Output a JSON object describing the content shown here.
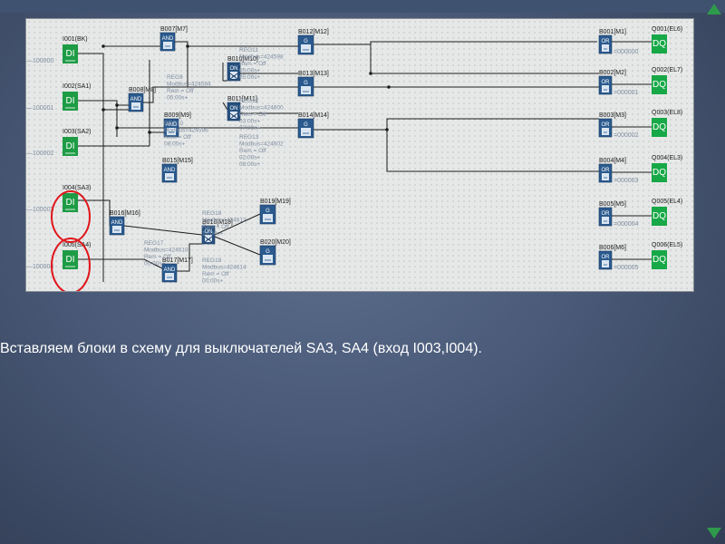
{
  "caption": "Вставляем блоки в схему для выключателей SA3, SA4 (вход I003,I004).",
  "colors": {
    "di_block": "#1e9c45",
    "q_block": "#17a847",
    "func_block": "#2a5a8e",
    "wire": "#1c1c1c",
    "note_text": "#7f8ea0",
    "highlight": "#e0161b",
    "slide_accent": "#2f9a4c"
  },
  "inputs": [
    {
      "label": "I001(BK)",
      "block": "DI",
      "ref": "100000"
    },
    {
      "label": "I002(SA1)",
      "block": "DI",
      "ref": "100001"
    },
    {
      "label": "I003(SA2)",
      "block": "DI",
      "ref": "100002"
    },
    {
      "label": "I004(SA3)",
      "block": "DI",
      "ref": "100003"
    },
    {
      "label": "I005(SA4)",
      "block": "DI",
      "ref": "100004"
    }
  ],
  "outputs": [
    {
      "label": "Q001(EL6)",
      "block": "DQ"
    },
    {
      "label": "Q002(EL7)",
      "block": "DQ"
    },
    {
      "label": "Q003(EL8)",
      "block": "DQ"
    },
    {
      "label": "Q004(EL3)",
      "block": "DQ"
    },
    {
      "label": "Q005(EL4)",
      "block": "DQ"
    },
    {
      "label": "Q006(EL5)",
      "block": "DQ"
    }
  ],
  "or_blocks": [
    {
      "label": "B001[M1]",
      "block": "OR",
      "ref": "=000000"
    },
    {
      "label": "B002[M2]",
      "block": "OR",
      "ref": "=000001"
    },
    {
      "label": "B003[M3]",
      "block": "OR",
      "ref": "=000002"
    },
    {
      "label": "B004[M4]",
      "block": "OR",
      "ref": "=000003"
    },
    {
      "label": "B005[M5]",
      "block": "OR",
      "ref": "=000004"
    },
    {
      "label": "B006[M6]",
      "block": "OR",
      "ref": "=000005"
    }
  ],
  "and_blocks": [
    {
      "label": "B007[M7]",
      "block": "AND"
    },
    {
      "label": "B008[M8]",
      "block": "AND"
    },
    {
      "label": "B009[M9]",
      "block": "AND"
    },
    {
      "label": "B015[M15]",
      "block": "AND"
    },
    {
      "label": "B016[M16]",
      "block": "AND"
    },
    {
      "label": "B017[M17]",
      "block": "AND"
    }
  ],
  "g_blocks": [
    {
      "label": "B012[M12]",
      "block": "G"
    },
    {
      "label": "B013[M13]",
      "block": "G"
    },
    {
      "label": "B014[M14]",
      "block": "G"
    },
    {
      "label": "B019[M19]",
      "block": "G"
    },
    {
      "label": "B020[M20]",
      "block": "G"
    }
  ],
  "timer_blocks": [
    {
      "label": "B010[M10]",
      "block": "ON"
    },
    {
      "label": "B011[M11]",
      "block": "ON"
    },
    {
      "label": "B018[M18]",
      "block": "ON"
    }
  ],
  "notes": [
    {
      "lines": [
        "REG11",
        "Modbus=424598",
        "Rem = Off",
        "05:00s+",
        "05:00s+"
      ]
    },
    {
      "lines": [
        "REG9",
        "Modbus=424594",
        "Rem = Off",
        "05:00s+"
      ]
    },
    {
      "lines": [
        "REG12",
        "Modbus=424600",
        "Rem = Off",
        "03:00s+",
        "07:00s+"
      ]
    },
    {
      "lines": [
        "REG10",
        "Modbus=424596",
        "Rem = Off",
        "08:00s+"
      ]
    },
    {
      "lines": [
        "REG13",
        "Modbus=424602",
        "Rem = Off",
        "02:00s+",
        "08:00s+"
      ]
    },
    {
      "lines": [
        "REG18",
        "Modbus=424612",
        "Rem = Off",
        "10:00s+"
      ]
    },
    {
      "lines": [
        "REG17",
        "Modbus=424610",
        "Rem = Off",
        "00:00s+"
      ]
    },
    {
      "lines": [
        "REG19",
        "Modbus=424614",
        "Rem = Off",
        "00:00s+"
      ]
    }
  ]
}
